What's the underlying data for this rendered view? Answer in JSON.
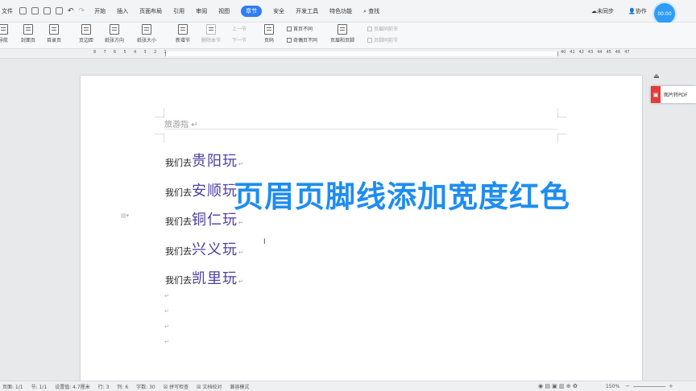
{
  "menubar": {
    "file": "文件",
    "tabs": [
      "开始",
      "插入",
      "页面布局",
      "引用",
      "审阅",
      "视图",
      "章节",
      "安全",
      "开发工具",
      "特色功能"
    ],
    "active_tab": "章节",
    "search": "查找",
    "sync": "未同步",
    "collab": "协作",
    "timer": "00:00"
  },
  "toolbar": {
    "nav": "导航",
    "cover": "封面页",
    "toc": "目录页",
    "margin": "页边距",
    "orientation": "纸张方向",
    "size": "纸张大小",
    "new_section": "新增节",
    "delete_section": "删除本节",
    "prev_section": "上一节",
    "next_section": "下一节",
    "header_footer": "页眉和页脚",
    "page_number": "页码",
    "first_diff": "首页不同",
    "odd_even": "奇偶页不同",
    "same_as_prev": "页眉同前节",
    "footer_same_prev": "页脚同前节"
  },
  "ruler": {
    "left_ticks": [
      "8",
      "7",
      "6",
      "5",
      "4",
      "3",
      "2",
      "1"
    ],
    "right_ticks": [
      "40",
      "41",
      "42",
      "43",
      "44",
      "45",
      "46",
      "47"
    ]
  },
  "document": {
    "header_text": "旅游指 ",
    "header_mark": "↵",
    "prefix": "我们去",
    "lines": [
      {
        "city": "贵阳玩"
      },
      {
        "city": "安顺玩"
      },
      {
        "city": "铜仁玩"
      },
      {
        "city": "兴义玩"
      },
      {
        "city": "凯里玩"
      }
    ],
    "return_mark": "↵"
  },
  "overlay_caption": "页眉页脚线添加宽度红色",
  "sidebar": {
    "pdf_label": "图片转PDF"
  },
  "statusbar": {
    "page": "页面: 1/1",
    "section": "节: 1/1",
    "setting": "设置值: 4.7厘米",
    "row": "行: 3",
    "col": "列: 6",
    "words": "字数: 30",
    "spell": "拼写检查",
    "doc_check": "文档校对",
    "compat": "兼容模式",
    "zoom": "150%"
  }
}
